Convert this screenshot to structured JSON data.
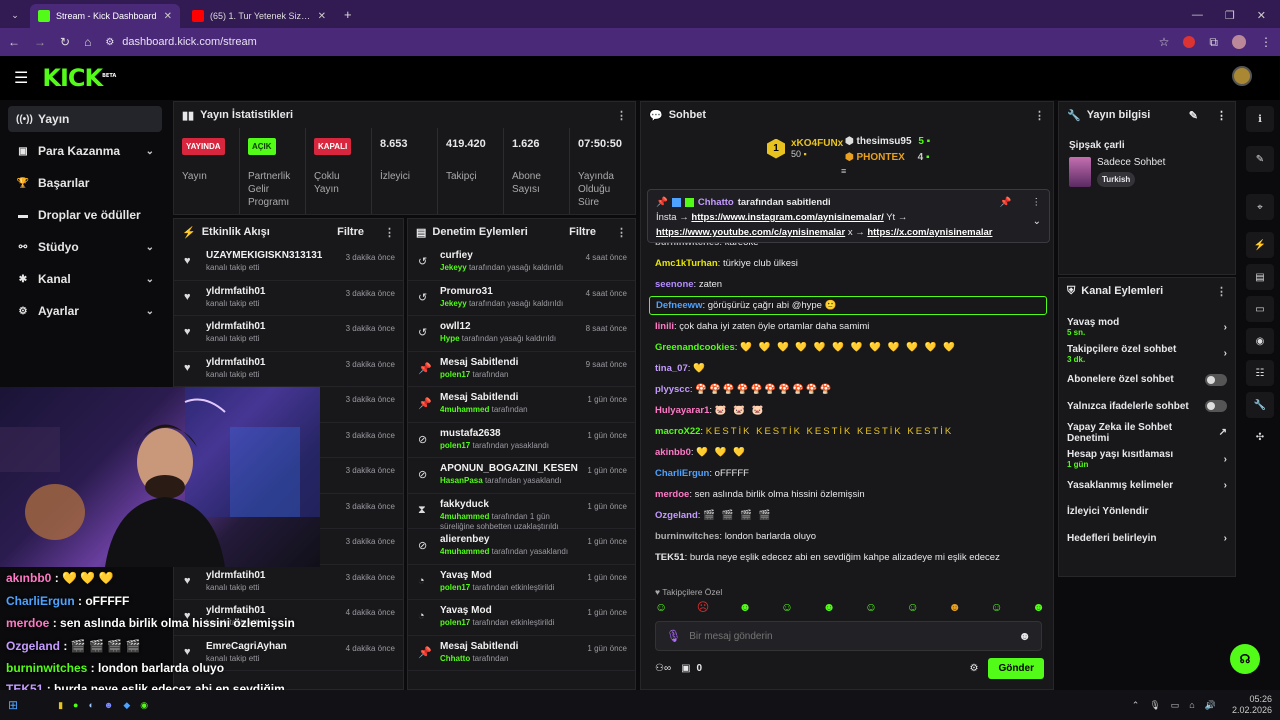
{
  "browser": {
    "tabs": [
      {
        "title": "Stream - Kick Dashboard",
        "color": "#53fc18"
      },
      {
        "title": "(65) 1. Tur Yetenek Sizsiniz Mah",
        "color": "#ff0000"
      }
    ],
    "url": "dashboard.kick.com/stream"
  },
  "brand": {
    "logo": "KICK",
    "beta": "BETA",
    "accent": "#53fc18"
  },
  "sidebar": {
    "items": [
      {
        "label": "Yayın",
        "icon": "broadcast-icon",
        "chev": ""
      },
      {
        "label": "Para Kazanma",
        "icon": "money-icon",
        "chev": "⌄"
      },
      {
        "label": "Başarılar",
        "icon": "trophy-icon",
        "chev": ""
      },
      {
        "label": "Droplar ve ödüller",
        "icon": "gift-icon",
        "chev": ""
      },
      {
        "label": "Stüdyo",
        "icon": "studio-icon",
        "chev": "⌄"
      },
      {
        "label": "Kanal",
        "icon": "channel-icon",
        "chev": "⌄"
      },
      {
        "label": "Ayarlar",
        "icon": "gear-icon",
        "chev": "⌄"
      }
    ]
  },
  "stats": {
    "title": "Yayın İstatistikleri",
    "items": [
      {
        "value": "YAYINDA",
        "label": "Yayın",
        "badge": "#d7263d"
      },
      {
        "value": "AÇIK",
        "label": "Partnerlik Gelir Programı",
        "badge": "#53fc18"
      },
      {
        "value": "KAPALI",
        "label": "Çoklu Yayın",
        "badge": "#d7263d"
      },
      {
        "value": "8.653",
        "label": "İzleyici"
      },
      {
        "value": "419.420",
        "label": "Takipçi"
      },
      {
        "value": "1.626",
        "label": "Abone Sayısı"
      },
      {
        "value": "07:50:50",
        "label": "Yayında Olduğu Süre"
      }
    ]
  },
  "activity": {
    "title": "Etkinlik Akışı",
    "filter": "Filtre",
    "rows": [
      {
        "user": "UZAYMEKIGISKN313131",
        "action": "kanalı takip etti",
        "time": "3 dakika önce"
      },
      {
        "user": "yldrmfatih01",
        "action": "kanalı takip etti",
        "time": "3 dakika önce"
      },
      {
        "user": "yldrmfatih01",
        "action": "kanalı takip etti",
        "time": "3 dakika önce"
      },
      {
        "user": "yldrmfatih01",
        "action": "kanalı takip etti",
        "time": "3 dakika önce"
      },
      {
        "user": "yldrmfatih01",
        "action": "kanalı takip etti",
        "time": "3 dakika önce"
      },
      {
        "user": "yldrmfatih01",
        "action": "kanalı takip etti",
        "time": "3 dakika önce"
      },
      {
        "user": "yldrmfatih01",
        "action": "kanalı takip etti",
        "time": "3 dakika önce"
      },
      {
        "user": "yldrmfatih01",
        "action": "kanalı takip etti",
        "time": "3 dakika önce"
      },
      {
        "user": "yldrmfatih01",
        "action": "kanalı takip etti",
        "time": "3 dakika önce"
      },
      {
        "user": "yldrmfatih01",
        "action": "kanalı takip etti",
        "time": "3 dakika önce"
      },
      {
        "user": "yldrmfatih01",
        "action": "kanalı takip etti",
        "time": "4 dakika önce"
      },
      {
        "user": "EmreCagriAyhan",
        "action": "kanalı takip etti",
        "time": "4 dakika önce"
      }
    ]
  },
  "moderation": {
    "title": "Denetim Eylemleri",
    "filter": "Filtre",
    "rows": [
      {
        "icon": "↺",
        "iname": "unban-icon",
        "title": "curfiey",
        "by": "Jekeyy",
        "action": "tarafından yasağı kaldırıldı",
        "time": "4 saat önce"
      },
      {
        "icon": "↺",
        "iname": "unban-icon",
        "title": "Promuro31",
        "by": "Jekeyy",
        "action": "tarafından yasağı kaldırıldı",
        "time": "4 saat önce"
      },
      {
        "icon": "↺",
        "iname": "unban-icon",
        "title": "owll12",
        "by": "Hype",
        "action": "tarafından yasağı kaldırıldı",
        "time": "8 saat önce"
      },
      {
        "icon": "📌",
        "iname": "pin-icon",
        "title": "Mesaj Sabitlendi",
        "by": "polen17",
        "action": "tarafından",
        "time": "9 saat önce"
      },
      {
        "icon": "📌",
        "iname": "pin-icon",
        "title": "Mesaj Sabitlendi",
        "by": "4muhammed",
        "action": "tarafından",
        "time": "1 gün önce"
      },
      {
        "icon": "⊘",
        "iname": "ban-icon",
        "title": "mustafa2638",
        "by": "polen17",
        "action": "tarafından yasaklandı",
        "time": "1 gün önce"
      },
      {
        "icon": "⊘",
        "iname": "ban-icon",
        "title": "APONUN_BOGAZINI_KESEN",
        "by": "HasanPasa",
        "action": "tarafından yasaklandı",
        "time": "1 gün önce"
      },
      {
        "icon": "⧗",
        "iname": "timeout-icon",
        "title": "fakkyduck",
        "by": "4muhammed",
        "action": "tarafından 1 gün süreliğine sohbetten uzaklaştırıldı",
        "time": "1 gün önce"
      },
      {
        "icon": "⊘",
        "iname": "ban-icon",
        "title": "alierenbey",
        "by": "4muhammed",
        "action": "tarafından yasaklandı",
        "time": "1 gün önce"
      },
      {
        "icon": "◔",
        "iname": "slow-mode-icon",
        "title": "Yavaş Mod",
        "by": "polen17",
        "action": "tarafından etkinleştirildi",
        "time": "1 gün önce"
      },
      {
        "icon": "◔",
        "iname": "slow-mode-icon",
        "title": "Yavaş Mod",
        "by": "polen17",
        "action": "tarafından etkinleştirildi",
        "time": "1 gün önce"
      },
      {
        "icon": "📌",
        "iname": "pin-icon",
        "title": "Mesaj Sabitlendi",
        "by": "Chhatto",
        "action": "tarafından",
        "time": "1 gün önce"
      }
    ]
  },
  "chat": {
    "title": "Sohbet",
    "leaders": [
      {
        "name": "xKO4FUNx",
        "count": "50",
        "color": "#e8c320"
      },
      {
        "name": "thesimsu95",
        "count": "5",
        "color": "#ffffff"
      },
      {
        "name": "PHONTEX",
        "count": "4",
        "color": "#e8a020"
      }
    ],
    "pinned": {
      "by": "Chhatto",
      "label": "tarafından sabitlendi",
      "line1_prefix": "İnsta →",
      "link1": "https://www.instagram.com/aynisinemalar/",
      "line1_suffix": "Yt →",
      "link2": "https://www.youtube.com/c/aynisinemalar",
      "line2_mid": "x →",
      "link3": "https://x.com/aynisinemalar"
    },
    "messages": [
      {
        "user": "burninwitches",
        "color": "#b0b0b0",
        "text": "kareoke",
        "emotes": ""
      },
      {
        "user": "Amc1kTurhan",
        "color": "#e6e600",
        "text": "türkiye club ülkesi",
        "emotes": ""
      },
      {
        "user": "seenone",
        "color": "#b28cff",
        "text": "zaten",
        "emotes": ""
      },
      {
        "user": "Defneeww",
        "color": "#4da3ff",
        "text": "görüşürüz çağrı abi @hype 🙂",
        "emotes": "",
        "highlight": true
      },
      {
        "user": "Iinili",
        "color": "#ff7ac6",
        "text": "çok daha iyi zaten öyle ortamlar daha samimi",
        "emotes": ""
      },
      {
        "user": "Greenandcookies",
        "color": "#53fc18",
        "text": "",
        "emotes": "💛 💛 💛 💛 💛 💛 💛 💛 💛 💛 💛 💛"
      },
      {
        "user": "tina_07",
        "color": "#c49cff",
        "text": "",
        "emotes": "💛"
      },
      {
        "user": "plyyscc",
        "color": "#c49cff",
        "text": "",
        "emotes": "🍄🍄🍄🍄🍄🍄🍄🍄🍄🍄"
      },
      {
        "user": "Hulyayarar1",
        "color": "#ff7ac6",
        "text": "",
        "emotes": "🐷 🐷 🐷"
      },
      {
        "user": "macroX22",
        "color": "#53fc18",
        "text": "",
        "emotes": "KESTİK KESTİK KESTİK KESTİK KESTİK"
      },
      {
        "user": "akinbb0",
        "color": "#ff7ac6",
        "text": "",
        "emotes": "💛 💛 💛"
      },
      {
        "user": "CharliErgun",
        "color": "#4da3ff",
        "text": "oFFFFF",
        "emotes": ""
      },
      {
        "user": "merdoe",
        "color": "#ff7ac6",
        "text": "sen aslında birlik olma hissini özlemişsin",
        "emotes": ""
      },
      {
        "user": "Ozgeland",
        "color": "#c49cff",
        "text": "",
        "emotes": "🎬 🎬 🎬 🎬"
      },
      {
        "user": "burninwitches",
        "color": "#b0b0b0",
        "text": "london barlarda oluyo",
        "emotes": ""
      },
      {
        "user": "TEK51",
        "color": "#e6e6e6",
        "text": "burda neye eşlik edecez abi en sevdiğim kahpe alizadeye mi eşlik edecez",
        "emotes": ""
      }
    ],
    "followers_only": "Takipçilere Özel",
    "placeholder": "Bir mesaj gönderin",
    "points": "0",
    "send": "Gönder"
  },
  "stream_info": {
    "title": "Yayın bilgisi",
    "stream_title": "Şipşak çarli",
    "category": "Sadece Sohbet",
    "tag": "Turkish"
  },
  "channel_actions": {
    "title": "Kanal Eylemleri",
    "rows": [
      {
        "label": "Yavaş mod",
        "sub": "5 sn.",
        "kind": "arrow"
      },
      {
        "label": "Takipçilere özel sohbet",
        "sub": "3 dk.",
        "kind": "arrow"
      },
      {
        "label": "Abonelere özel sohbet",
        "sub": "",
        "kind": "toggle"
      },
      {
        "label": "Yalnızca ifadelerle sohbet",
        "sub": "",
        "kind": "toggle"
      },
      {
        "label": "Yapay Zeka ile Sohbet Denetimi",
        "sub": "",
        "kind": "ext"
      },
      {
        "label": "Hesap yaşı kısıtlaması",
        "sub": "1 gün",
        "kind": "arrow"
      },
      {
        "label": "Yasaklanmış kelimeler",
        "sub": "",
        "kind": "arrow"
      },
      {
        "label": "İzleyici Yönlendir",
        "sub": "",
        "kind": "none"
      },
      {
        "label": "Hedefleri belirleyin",
        "sub": "",
        "kind": "arrow"
      }
    ]
  },
  "overlay_chat": [
    {
      "user": "akınbb0",
      "text": "",
      "emotes": "💛 💛 💛",
      "color": "#ff7ac6"
    },
    {
      "user": "CharliErgun",
      "text": "oFFFFF",
      "emotes": "",
      "color": "#4da3ff"
    },
    {
      "user": "merdoe",
      "text": "sen aslında birlik olma hissini özlemişsin",
      "emotes": "",
      "color": "#ff7ac6"
    },
    {
      "user": "Ozgeland",
      "text": "",
      "emotes": "🎬 🎬 🎬 🎬",
      "color": "#c49cff"
    },
    {
      "user": "burninwitches",
      "text": "london barlarda oluyo",
      "emotes": "",
      "color": "#53fc18"
    },
    {
      "user": "TEK51",
      "text": "burda neye eşlik edecez abi en sevdiğim kahpe alizadeye mi eşlik edecez",
      "emotes": "",
      "color": "#c49cff"
    }
  ],
  "taskbar": {
    "time": "05:26",
    "date": "2.02.2026"
  }
}
